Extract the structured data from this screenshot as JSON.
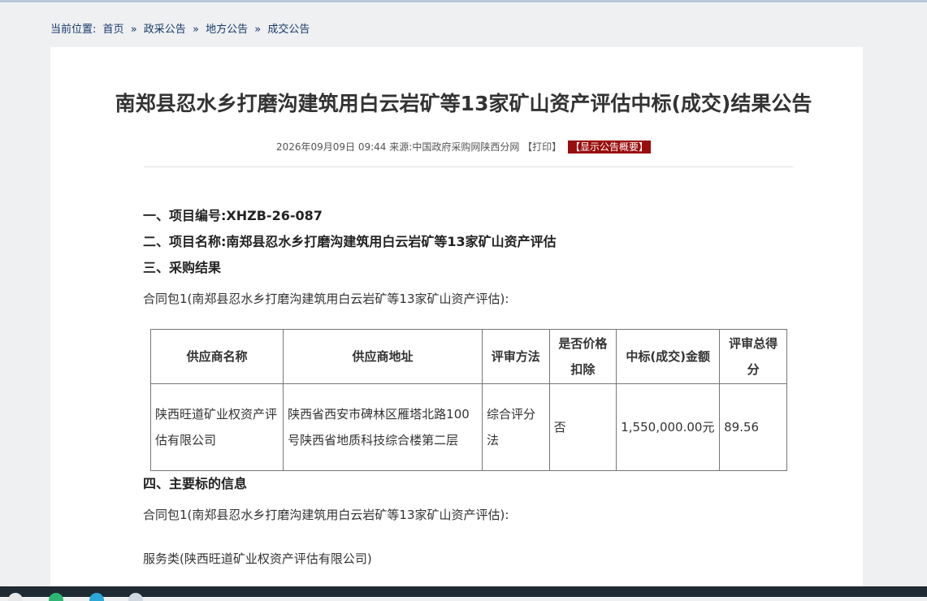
{
  "breadcrumb": {
    "label": "当前位置:",
    "items": [
      "首页",
      "政采公告",
      "地方公告",
      "成交公告"
    ],
    "separator": "»"
  },
  "title": "南郑县忍水乡打磨沟建筑用白云岩矿等13家矿山资产评估中标(成交)结果公告",
  "meta": {
    "datetime": "2026年09月09日 09:44",
    "source_label": "来源:",
    "source": "中国政府采购网陕西分网",
    "print": "【打印】",
    "summary": "【显示公告概要】"
  },
  "sections": {
    "s1": "一、项目编号:XHZB-26-087",
    "s2": "二、项目名称:南郑县忍水乡打磨沟建筑用白云岩矿等13家矿山资产评估",
    "s3": "三、采购结果",
    "package1": "合同包1(南郑县忍水乡打磨沟建筑用白云岩矿等13家矿山资产评估):",
    "s4": "四、主要标的信息",
    "package2": "合同包1(南郑县忍水乡打磨沟建筑用白云岩矿等13家矿山资产评估):",
    "service": "服务类(陕西旺道矿业权资产评估有限公司)"
  },
  "table": {
    "headers": [
      "供应商名称",
      "供应商地址",
      "评审方法",
      "是否价格扣除",
      "中标(成交)金额",
      "评审总得分"
    ],
    "rows": [
      [
        "陕西旺道矿业权资产评估有限公司",
        "陕西省西安市碑林区雁塔北路100号陕西省地质科技综合楼第二层",
        "综合评分法",
        "否",
        "1,550,000.00元",
        "89.56"
      ]
    ]
  },
  "colors": {
    "summary_button": "#9a0d0d",
    "taskbar": "#1f2a33"
  }
}
